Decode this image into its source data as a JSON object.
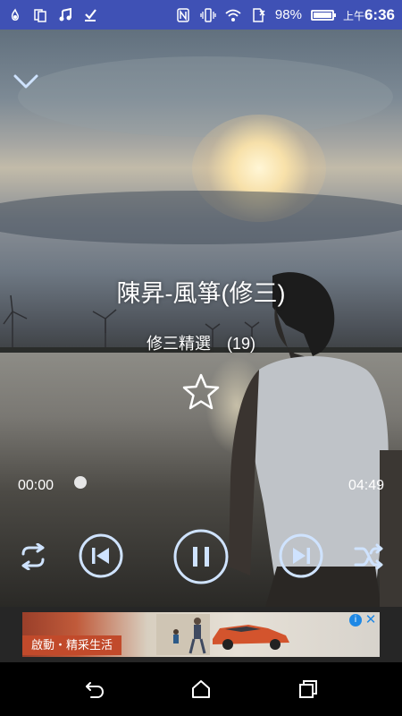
{
  "status_bar": {
    "battery_percent": "98%",
    "am_pm": "上午",
    "time": "6:36",
    "icons": [
      "fire-tv-icon",
      "copy-icon",
      "music-note-icon",
      "download-check-icon",
      "nfc-icon",
      "vibrate-icon",
      "wifi-icon",
      "no-sim-icon",
      "battery-icon"
    ]
  },
  "player": {
    "song_title": "陳昇-風箏(修三)",
    "album": "修三精選　(19)",
    "current_time": "00:00",
    "total_time": "04:49",
    "progress_fraction": 0.0,
    "favorite": false,
    "icons": [
      "chevron-down-icon",
      "star-icon",
      "repeat-icon",
      "previous-icon",
      "pause-icon",
      "next-icon",
      "shuffle-icon"
    ]
  },
  "ad": {
    "label": "啟動・精采生活",
    "info_glyph": "i",
    "close_glyph": "✕"
  },
  "nav_bar": {
    "icons": [
      "back-icon",
      "home-icon",
      "recents-icon"
    ]
  },
  "colors": {
    "status_bar": "#3f51b5",
    "ad_accent": "#c14a2b",
    "ad_info": "#1e88e5"
  }
}
